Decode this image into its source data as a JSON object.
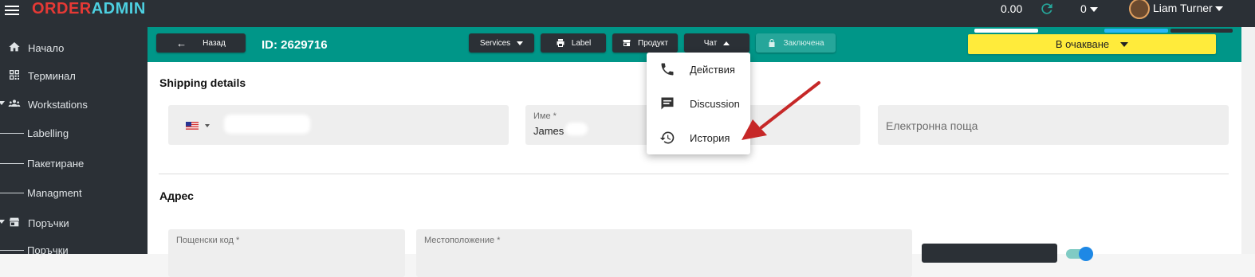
{
  "app": {
    "brand_part1": "ORDER",
    "brand_part2": "ADMIN",
    "balance": "0.00",
    "count": "0",
    "user_name": "Liam Turner"
  },
  "sidebar": {
    "items": [
      {
        "label": "Начало",
        "icon": "home-icon"
      },
      {
        "label": "Терминал",
        "icon": "qr-code-icon"
      },
      {
        "label": "Workstations",
        "icon": "people-icon"
      },
      {
        "label": "Labelling"
      },
      {
        "label": "Пакетиране"
      },
      {
        "label": "Managment"
      },
      {
        "label": "Поръчки",
        "icon": "store-icon"
      },
      {
        "label": "Поръчки"
      }
    ]
  },
  "toolbar": {
    "back_label": "Назад",
    "order_id": "ID: 2629716",
    "services_label": "Services",
    "label_label": "Label",
    "product_label": "Продукт",
    "chat_label": "Чат",
    "locked_label": "Заключена",
    "status_value": "В очакване"
  },
  "chat_menu": {
    "items": [
      {
        "label": "Действия",
        "icon": "phone-icon"
      },
      {
        "label": "Discussion",
        "icon": "comment-icon"
      },
      {
        "label": "История",
        "icon": "history-icon"
      }
    ]
  },
  "shipping": {
    "title": "Shipping details",
    "name_label": "Име *",
    "name_value": "James",
    "email_placeholder": "Електронна поща"
  },
  "address": {
    "title": "Адрес",
    "postal_label": "Пощенски код *",
    "location_label": "Местоположение *"
  },
  "colors": {
    "teal": "#009688",
    "dark": "#2b3036",
    "status_yellow": "#ffeb3b",
    "arrow_red": "#c62828"
  }
}
